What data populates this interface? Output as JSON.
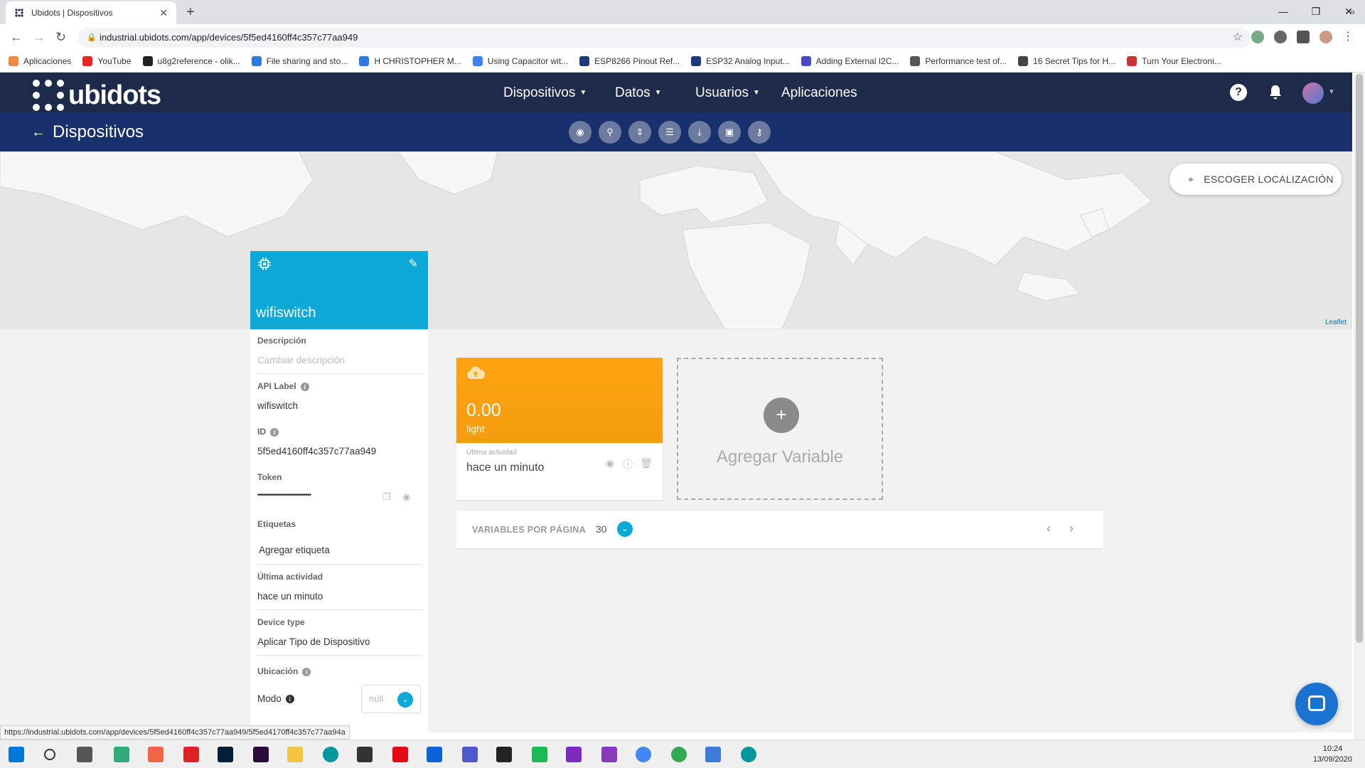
{
  "browser": {
    "tab_title": "Ubidots | Dispositivos",
    "url": "industrial.ubidots.com/app/devices/5f5ed4160ff4c357c77aa949",
    "bookmarks": [
      {
        "label": "Aplicaciones",
        "color": "#e84"
      },
      {
        "label": "YouTube",
        "color": "#e22"
      },
      {
        "label": "u8g2reference - olik...",
        "color": "#222"
      },
      {
        "label": "File sharing and sto...",
        "color": "#2a7ae2"
      },
      {
        "label": "H CHRISTOPHER M...",
        "color": "#2a7ae2"
      },
      {
        "label": "Using Capacitor wit...",
        "color": "#3b82f6"
      },
      {
        "label": "ESP8266 Pinout Ref...",
        "color": "#1c3a7a"
      },
      {
        "label": "ESP32 Analog Input...",
        "color": "#1c3a7a"
      },
      {
        "label": "Adding External I2C...",
        "color": "#4a4ac0"
      },
      {
        "label": "Performance test of...",
        "color": "#555"
      },
      {
        "label": "16 Secret Tips for H...",
        "color": "#444"
      },
      {
        "label": "Turn Your Electroni...",
        "color": "#c33"
      }
    ],
    "status_url": "https://industrial.ubidots.com/app/devices/5f5ed4160ff4c357c77aa949/5f5ed4170ff4c357c77aa94a"
  },
  "header": {
    "logo": "ubidots",
    "menu": [
      "Dispositivos",
      "Datos",
      "Usuarios",
      "Aplicaciones"
    ]
  },
  "subnav": {
    "back_label": "Dispositivos"
  },
  "map": {
    "location_button": "ESCOGER LOCALIZACIÓN",
    "attribution": "Leaflet"
  },
  "device": {
    "name": "wifiswitch",
    "descripcion_label": "Descripción",
    "descripcion_placeholder": "Cambiar descripción",
    "api_label_label": "API Label",
    "api_label_value": "wifiswitch",
    "id_label": "ID",
    "id_value": "5f5ed4160ff4c357c77aa949",
    "token_label": "Token",
    "token_value": "••••••••••••••••••••••••••••••",
    "etiquetas_label": "Etiquetas",
    "etiquetas_value": "Agregar etiqueta",
    "ultima_label": "Última actividad",
    "ultima_value": "hace un minuto",
    "device_type_label": "Device type",
    "device_type_value": "Aplicar Tipo de Dispositivo",
    "ubicacion_label": "Ubicación",
    "modo_label": "Modo",
    "modo_value": "null"
  },
  "variable": {
    "value": "0.00",
    "name": "light",
    "last_activity_label": "Última actividad",
    "last_activity_value": "hace un minuto"
  },
  "add_variable": {
    "label": "Agregar Variable"
  },
  "pager": {
    "label": "VARIABLES POR PÁGINA",
    "count": "30"
  },
  "taskbar": {
    "time": "10:24",
    "date": "13/09/2020"
  },
  "colors": {
    "nav_dark": "#1e2a4a",
    "subnav": "#18306b",
    "device_accent": "#0ba8d8",
    "variable_orange": "#ffa412"
  }
}
